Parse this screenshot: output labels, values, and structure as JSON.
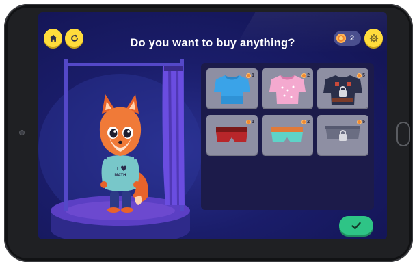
{
  "header": {
    "title": "Do you want to buy anything?",
    "coins": "2"
  },
  "icons": {
    "home": "home-icon",
    "restart": "restart-icon",
    "settings": "gear-icon",
    "confirm": "checkmark-icon",
    "lock": "lock-icon",
    "coin": "coin-icon"
  },
  "character": {
    "shirt_text_top": "I",
    "shirt_text_bottom": "MATH"
  },
  "shop": {
    "items": [
      {
        "name": "blue shirt",
        "price": "1",
        "locked": false
      },
      {
        "name": "pink shirt",
        "price": "2",
        "locked": false
      },
      {
        "name": "dark shirt",
        "price": "5",
        "locked": true
      },
      {
        "name": "red shorts",
        "price": "1",
        "locked": false
      },
      {
        "name": "teal shorts",
        "price": "2",
        "locked": false
      },
      {
        "name": "grey shorts",
        "price": "5",
        "locked": true
      }
    ]
  },
  "colors": {
    "accent_yellow": "#ffdc3c",
    "confirm_green": "#2ec486",
    "panel": "#1c1b4a",
    "background": "#1a1d6a"
  }
}
